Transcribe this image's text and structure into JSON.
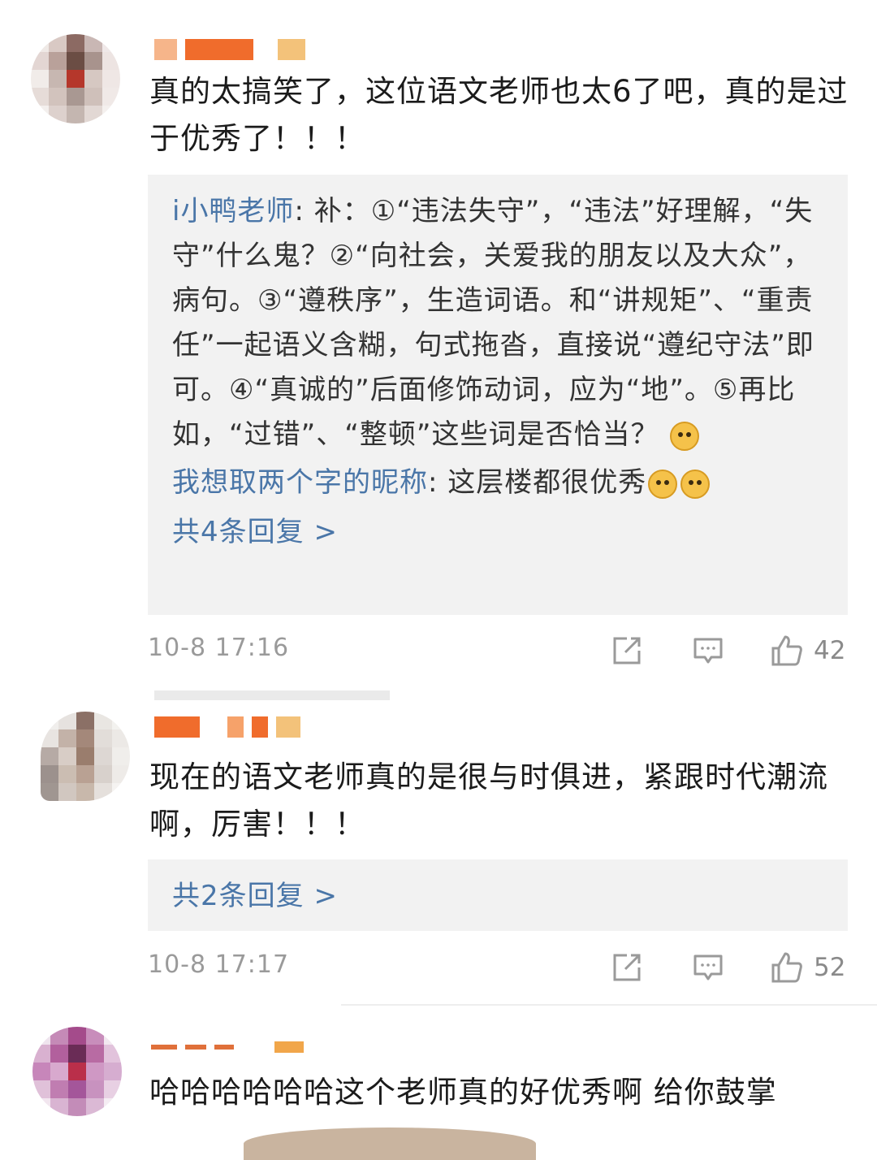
{
  "comments": [
    {
      "text": "真的太搞笑了，这位语文老师也太6了吧，真的是过于优秀了！！！",
      "replies": [
        {
          "author": "i小鸭老师",
          "text": ": 补：①“违法失守”，“违法”好理解，“失守”什么鬼？②“向社会，关爱我的朋友以及大众”，病句。③“遵秩序”，生造词语。和“讲规矩”、“重责任”一起语义含糊，句式拖沓，直接说“遵纪守法”即可。④“真诚的”后面修饰动词，应为“地”。⑤再比如，“过错”、“整顿”这些词是否恰当？"
        },
        {
          "author": "我想取两个字的昵称",
          "text": ": 这层楼都很优秀"
        }
      ],
      "more_replies": "共4条回复 >",
      "time": "10-8 17:16",
      "likes": "42"
    },
    {
      "text": "现在的语文老师真的是很与时俱进，紧跟时代潮流啊，厉害！！！",
      "more_replies": "共2条回复 >",
      "time": "10-8 17:17",
      "likes": "52"
    },
    {
      "text": "哈哈哈哈哈哈这个老师真的好优秀啊 给你鼓掌"
    }
  ],
  "icons": {
    "share": "share-icon",
    "comment": "comment-icon",
    "like": "like-icon"
  },
  "colors": {
    "link": "#4a76a8",
    "reply_bg": "#f2f2f2",
    "meta": "#9a9a9a"
  }
}
